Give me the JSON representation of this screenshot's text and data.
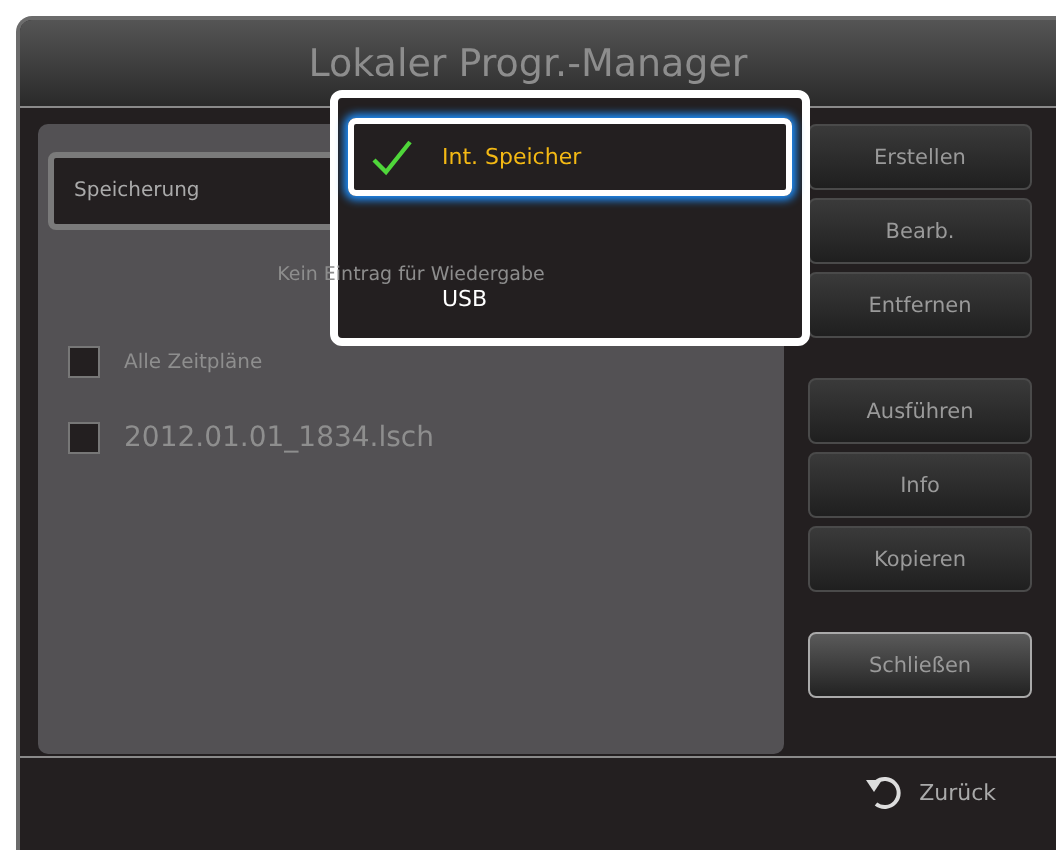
{
  "window": {
    "title": "Lokaler Progr.-Manager"
  },
  "storage_field": {
    "label": "Speicherung"
  },
  "empty_message": "Kein Eintrag für Wiedergabe",
  "list": [
    {
      "label": "Alle Zeitpläne",
      "checked": false,
      "kind": "small"
    },
    {
      "label": "2012.01.01_1834.lsch",
      "checked": false,
      "kind": "large"
    }
  ],
  "buttons": [
    {
      "label": "Erstellen",
      "focused": false
    },
    {
      "label": "Bearb.",
      "focused": false
    },
    {
      "label": "Entfernen",
      "focused": false
    },
    {
      "label": "Ausführen",
      "focused": false
    },
    {
      "label": "Info",
      "focused": false
    },
    {
      "label": "Kopieren",
      "focused": false
    },
    {
      "label": "Schließen",
      "focused": true
    }
  ],
  "dropdown": {
    "options": [
      {
        "label": "Int. Speicher",
        "selected": true
      },
      {
        "label": "USB",
        "selected": false
      }
    ]
  },
  "footer": {
    "back_label": "Zurück"
  }
}
